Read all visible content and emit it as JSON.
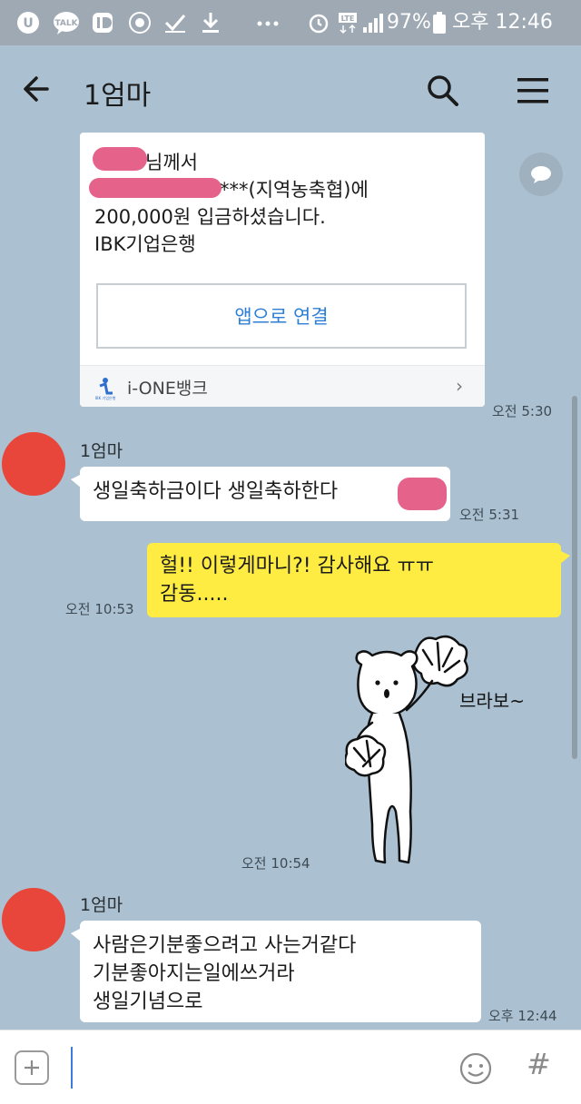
{
  "status_bar": {
    "battery": "97%",
    "time": "오후 12:46",
    "network": "LTE",
    "icons": [
      "u-plus-icon",
      "kakaotalk-icon",
      "id-icon",
      "weather-icon",
      "check-icon",
      "download-icon",
      "more-icon",
      "alarm-icon",
      "lte-icon",
      "signal-icon",
      "battery-icon"
    ],
    "kakaotalk_label": "TALK"
  },
  "header": {
    "title": "1엄마"
  },
  "bank_message": {
    "line1_suffix": "님께서",
    "line2_suffix": "***(지역농축협)에",
    "line3": "200,000원 입금하셨습니다.",
    "line4": "IBK기업은행",
    "app_link_label": "앱으로 연결",
    "footer_label": "i-ONE뱅크",
    "logo_text": "IBK 기업은행",
    "time": "오전 5:30"
  },
  "messages": [
    {
      "sender": "1엄마",
      "text": "생일축하금이다 생일축하한다",
      "time": "오전 5:31"
    },
    {
      "sender": "me",
      "line1": "헐!! 이렇게마니?! 감사해요 ㅠㅠ",
      "line2": "감동.....",
      "time": "오전 10:53"
    },
    {
      "sender": "me",
      "sticker_text": "브라보~",
      "time": "오전 10:54"
    },
    {
      "sender": "1엄마",
      "line1": "사람은기분좋으려고 사는거같다",
      "line2": "기분좋아지는일에쓰거라",
      "line3": "생일기념으로",
      "time": "오후 12:44"
    }
  ],
  "input": {
    "placeholder": "",
    "value": ""
  },
  "colors": {
    "chat_background": "#abc1d1",
    "outgoing_bubble": "#ffec42",
    "incoming_bubble": "#ffffff",
    "avatar": "#e8463a",
    "redaction": "#e5628a",
    "link": "#2d7fd6"
  }
}
